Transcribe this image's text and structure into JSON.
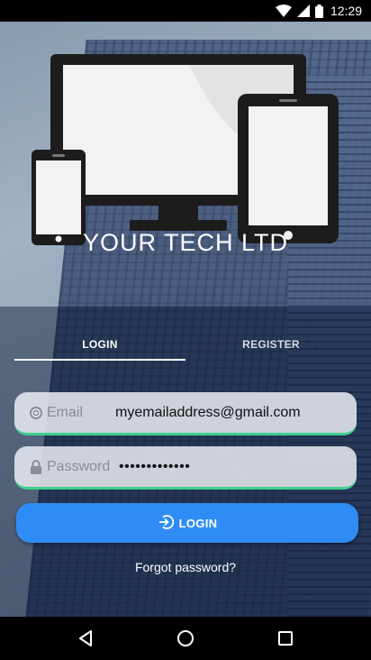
{
  "status": {
    "time": "12:29"
  },
  "brand": {
    "name": "YOUR TECH LTD"
  },
  "tabs": [
    {
      "label": "LOGIN",
      "active": true
    },
    {
      "label": "REGISTER",
      "active": false
    }
  ],
  "form": {
    "email": {
      "hint": "Email",
      "value": "myemailaddress@gmail.com"
    },
    "password": {
      "hint": "Password",
      "value": "•••••••••••••"
    },
    "login_label": "LOGIN",
    "forgot_label": "Forgot password?"
  },
  "colors": {
    "accent": "#2f8cf4",
    "field_underline": "#3ecf8e"
  },
  "icons": {
    "email": "at-icon",
    "password": "lock-icon",
    "login": "login-arrow-icon",
    "nav_back": "back-triangle-icon",
    "nav_home": "home-circle-icon",
    "nav_recent": "recent-square-icon"
  }
}
